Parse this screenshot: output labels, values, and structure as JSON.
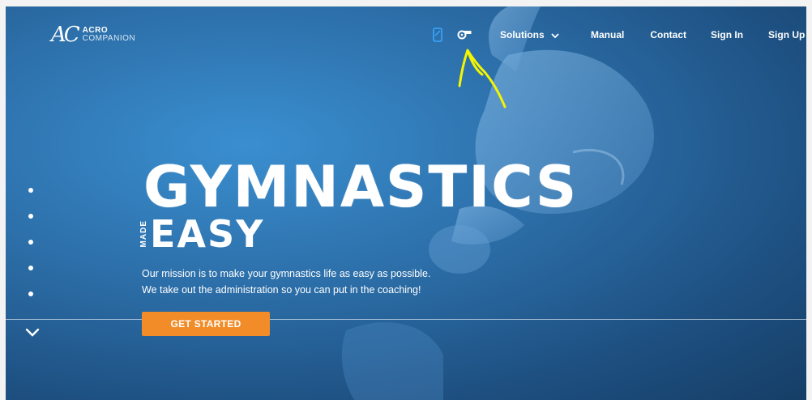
{
  "logo": {
    "mark": "AC",
    "line1": "ACRO",
    "line2": "COMPANION"
  },
  "nav": {
    "icons": [
      "mobile-icon",
      "whistle-icon"
    ],
    "solutions": "Solutions",
    "manual": "Manual",
    "contact": "Contact",
    "sign_in": "Sign In",
    "sign_up": "Sign Up"
  },
  "hero": {
    "title": "GYMNASTICS",
    "made": "MADE",
    "easy": "EASY",
    "mission_line1": "Our mission is to make your gymnastics life as easy as possible.",
    "mission_line2": "We take out the administration so you can put in the coaching!",
    "cta": "GET STARTED"
  },
  "slider": {
    "dot_count": 5
  },
  "colors": {
    "accent": "#f28c28",
    "nav_icon_blue": "#3aa7ff",
    "annotation": "#f5f500",
    "bg_light": "#3a8fd0",
    "bg_dark": "#163e66"
  }
}
